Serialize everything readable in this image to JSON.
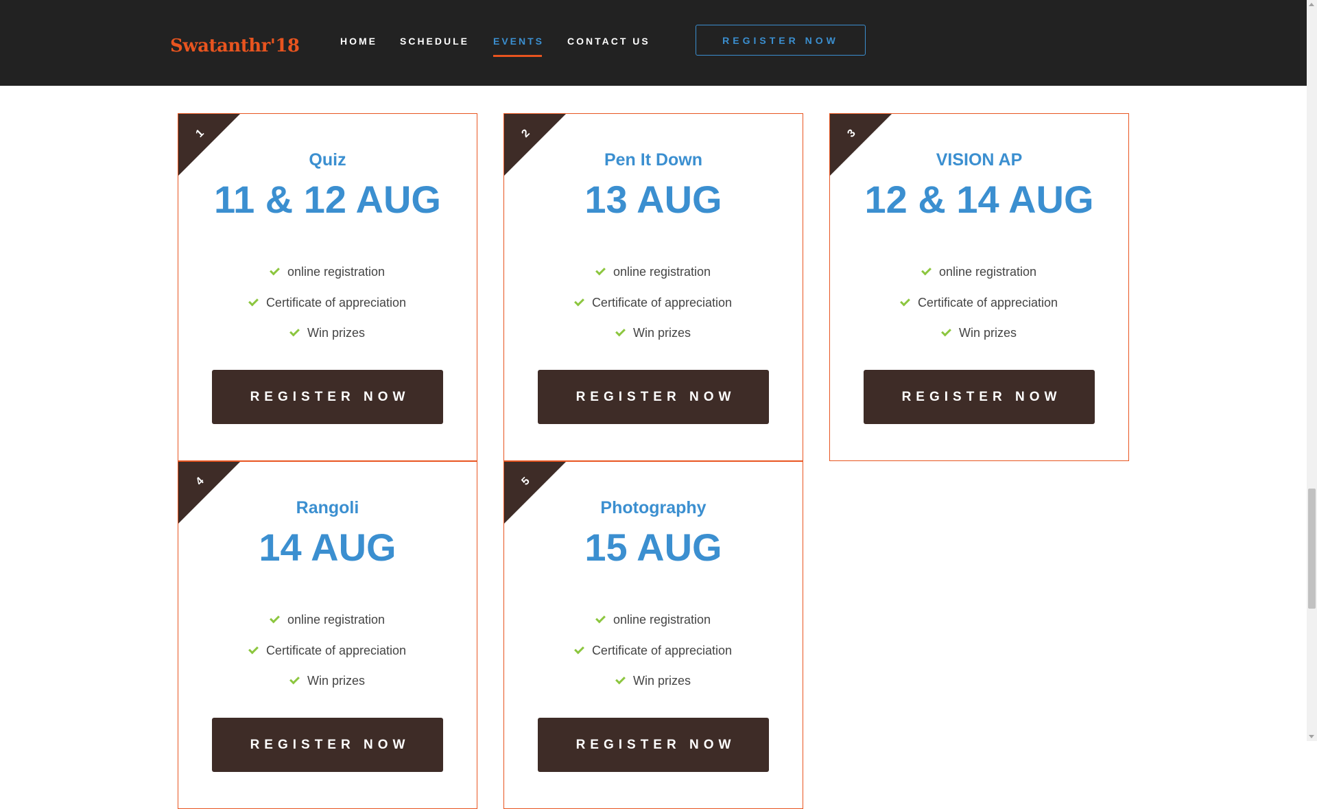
{
  "header": {
    "brand": "Swatanthr'18",
    "nav": [
      {
        "label": "HOME",
        "active": false
      },
      {
        "label": "SCHEDULE",
        "active": false
      },
      {
        "label": "EVENTS",
        "active": true
      },
      {
        "label": "CONTACT US",
        "active": false
      }
    ],
    "register_label": "REGISTER NOW"
  },
  "events": [
    {
      "number": "1",
      "title": "Quiz",
      "date": "11 & 12 AUG",
      "features": [
        "online registration",
        "Certificate of appreciation",
        "Win prizes"
      ],
      "button": "REGISTER NOW"
    },
    {
      "number": "2",
      "title": "Pen It Down",
      "date": "13 AUG",
      "features": [
        "online registration",
        "Certificate of appreciation",
        "Win prizes"
      ],
      "button": "REGISTER NOW"
    },
    {
      "number": "3",
      "title": "VISION AP",
      "date": "12 & 14 AUG",
      "features": [
        "online registration",
        "Certificate of appreciation",
        "Win prizes"
      ],
      "button": "REGISTER NOW"
    },
    {
      "number": "4",
      "title": "Rangoli",
      "date": "14 AUG",
      "features": [
        "online registration",
        "Certificate of appreciation",
        "Win prizes"
      ],
      "button": "REGISTER NOW"
    },
    {
      "number": "5",
      "title": "Photography",
      "date": "15 AUG",
      "features": [
        "online registration",
        "Certificate of appreciation",
        "Win prizes"
      ],
      "button": "REGISTER NOW"
    }
  ],
  "colors": {
    "accent": "#3b8fd0",
    "brand": "#e8541f",
    "dark": "#3e2c27",
    "check": "#8cc63f",
    "nav_bg": "#222222"
  }
}
